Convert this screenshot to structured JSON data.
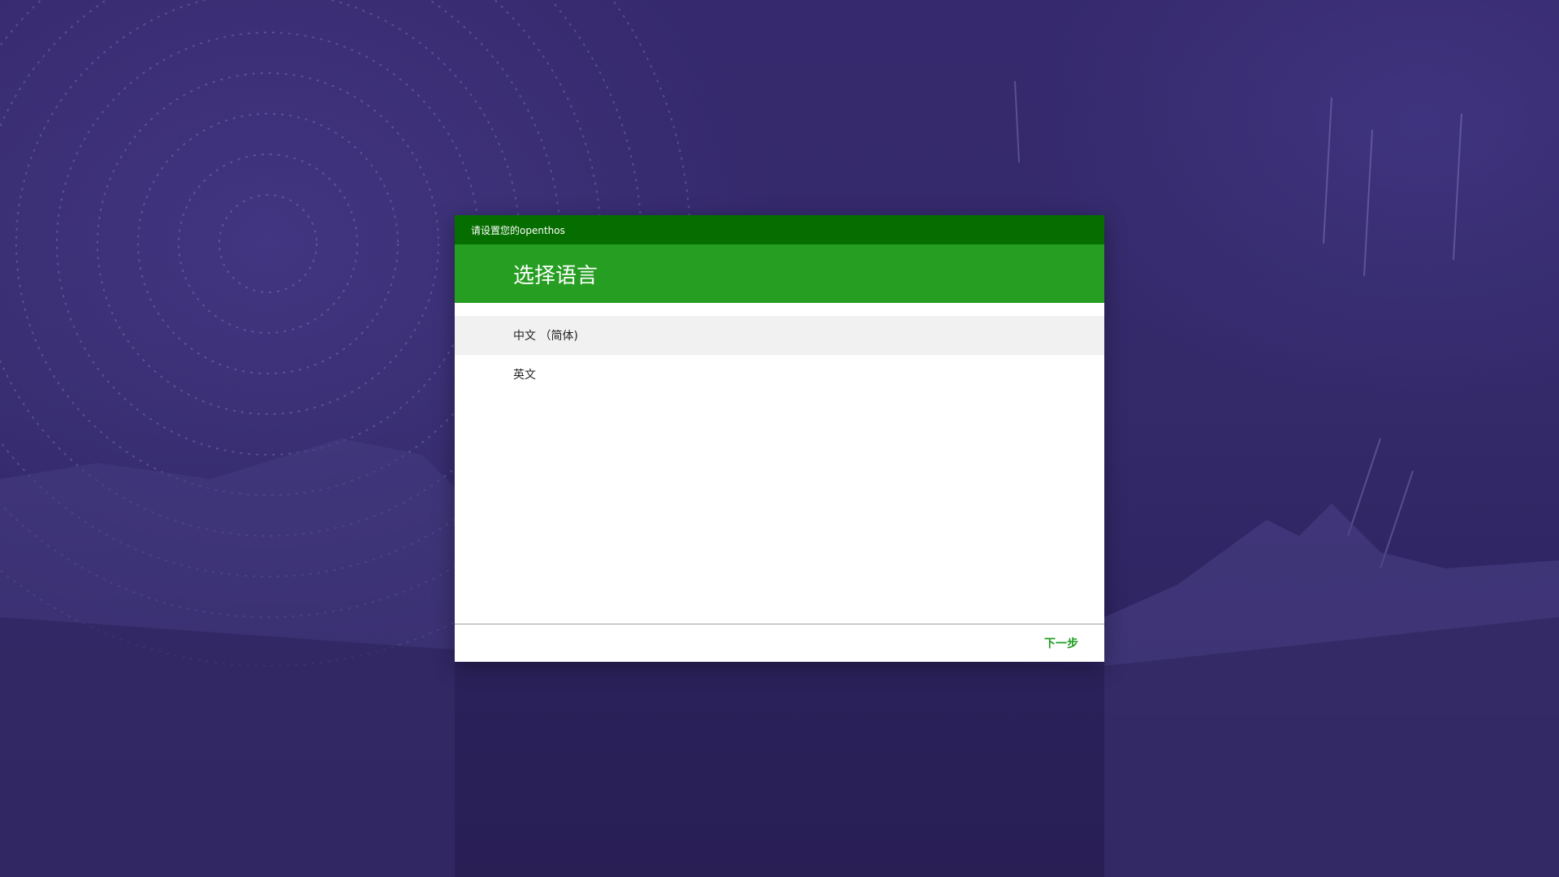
{
  "window": {
    "status_title": "请设置您的openthos"
  },
  "header": {
    "title": "选择语言"
  },
  "languages": [
    {
      "label": "中文 （简体)",
      "selected": true
    },
    {
      "label": "英文",
      "selected": false
    }
  ],
  "footer": {
    "next_label": "下一步"
  },
  "colors": {
    "status_bar": "#066e00",
    "title_bar": "#269e22",
    "accent_text": "#1d9a1d",
    "selected_row": "#f1f1f1",
    "background": "#342a6a"
  }
}
